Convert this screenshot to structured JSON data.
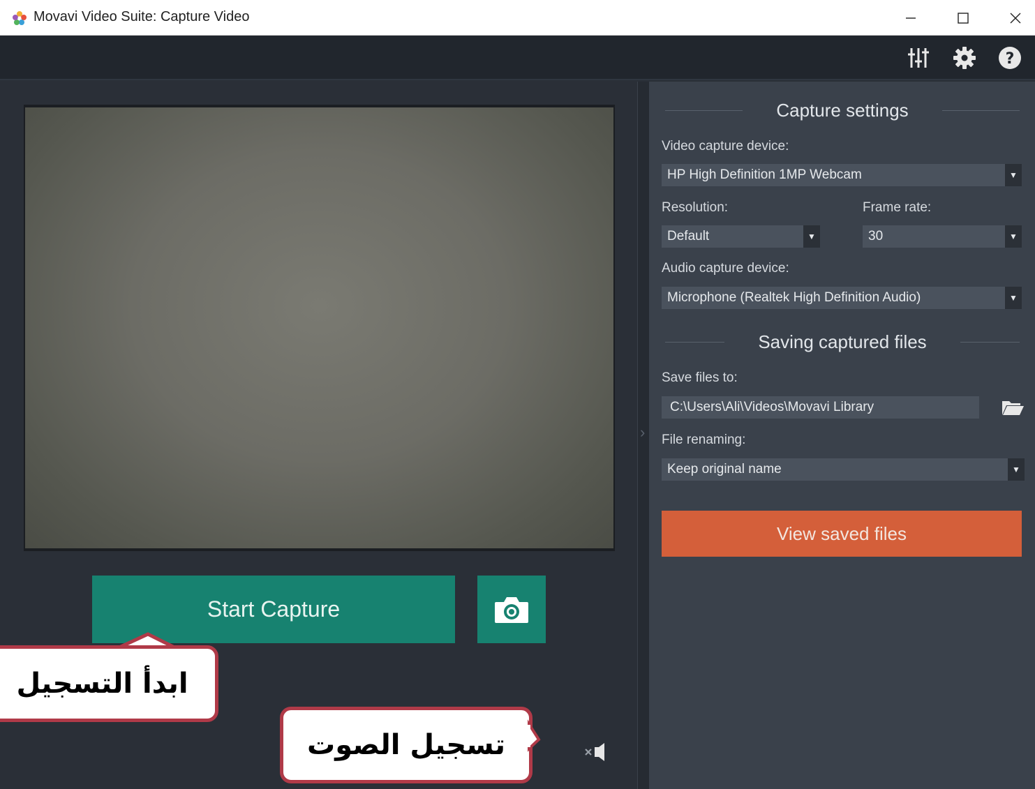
{
  "window": {
    "title": "Movavi Video Suite: Capture Video",
    "icons": [
      "app-logo-icon",
      "minimize-icon",
      "maximize-icon",
      "close-icon"
    ]
  },
  "toolbar": {
    "icons": [
      "mixer-icon",
      "gear-icon",
      "help-icon"
    ]
  },
  "left_panel": {
    "start_capture_label": "Start Capture",
    "snapshot_icon": "camera-icon",
    "mute_icon": "speaker-muted-icon"
  },
  "capture_settings": {
    "heading": "Capture settings",
    "video_device_label": "Video capture device:",
    "video_device_value": "HP High Definition 1MP Webcam",
    "resolution_label": "Resolution:",
    "resolution_value": "Default",
    "frame_rate_label": "Frame rate:",
    "frame_rate_value": "30",
    "audio_device_label": "Audio capture device:",
    "audio_device_value": "Microphone (Realtek High Definition Audio)"
  },
  "saving": {
    "heading": "Saving captured files",
    "save_to_label": "Save files to:",
    "save_to_value": "C:\\Users\\Ali\\Videos\\Movavi Library",
    "renaming_label": "File renaming:",
    "renaming_value": "Keep original name",
    "view_button_label": "View saved files"
  },
  "annotations": {
    "start_recording": "ابدأ التسجيل",
    "audio_recording": "تسجيل الصوت"
  },
  "colors": {
    "accent_green": "#178270",
    "accent_orange": "#d45f3a",
    "callout_border": "#b03a48"
  }
}
